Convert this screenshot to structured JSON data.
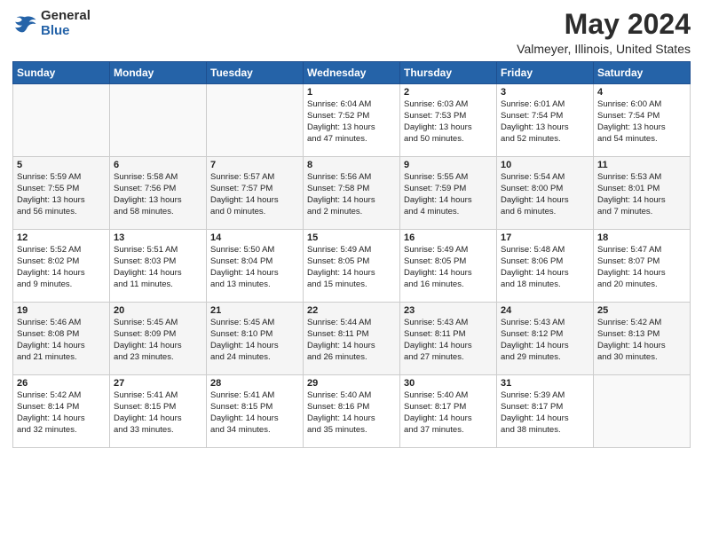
{
  "header": {
    "logo_general": "General",
    "logo_blue": "Blue",
    "month_title": "May 2024",
    "location": "Valmeyer, Illinois, United States"
  },
  "weekdays": [
    "Sunday",
    "Monday",
    "Tuesday",
    "Wednesday",
    "Thursday",
    "Friday",
    "Saturday"
  ],
  "weeks": [
    [
      {
        "day": "",
        "info": ""
      },
      {
        "day": "",
        "info": ""
      },
      {
        "day": "",
        "info": ""
      },
      {
        "day": "1",
        "info": "Sunrise: 6:04 AM\nSunset: 7:52 PM\nDaylight: 13 hours\nand 47 minutes."
      },
      {
        "day": "2",
        "info": "Sunrise: 6:03 AM\nSunset: 7:53 PM\nDaylight: 13 hours\nand 50 minutes."
      },
      {
        "day": "3",
        "info": "Sunrise: 6:01 AM\nSunset: 7:54 PM\nDaylight: 13 hours\nand 52 minutes."
      },
      {
        "day": "4",
        "info": "Sunrise: 6:00 AM\nSunset: 7:54 PM\nDaylight: 13 hours\nand 54 minutes."
      }
    ],
    [
      {
        "day": "5",
        "info": "Sunrise: 5:59 AM\nSunset: 7:55 PM\nDaylight: 13 hours\nand 56 minutes."
      },
      {
        "day": "6",
        "info": "Sunrise: 5:58 AM\nSunset: 7:56 PM\nDaylight: 13 hours\nand 58 minutes."
      },
      {
        "day": "7",
        "info": "Sunrise: 5:57 AM\nSunset: 7:57 PM\nDaylight: 14 hours\nand 0 minutes."
      },
      {
        "day": "8",
        "info": "Sunrise: 5:56 AM\nSunset: 7:58 PM\nDaylight: 14 hours\nand 2 minutes."
      },
      {
        "day": "9",
        "info": "Sunrise: 5:55 AM\nSunset: 7:59 PM\nDaylight: 14 hours\nand 4 minutes."
      },
      {
        "day": "10",
        "info": "Sunrise: 5:54 AM\nSunset: 8:00 PM\nDaylight: 14 hours\nand 6 minutes."
      },
      {
        "day": "11",
        "info": "Sunrise: 5:53 AM\nSunset: 8:01 PM\nDaylight: 14 hours\nand 7 minutes."
      }
    ],
    [
      {
        "day": "12",
        "info": "Sunrise: 5:52 AM\nSunset: 8:02 PM\nDaylight: 14 hours\nand 9 minutes."
      },
      {
        "day": "13",
        "info": "Sunrise: 5:51 AM\nSunset: 8:03 PM\nDaylight: 14 hours\nand 11 minutes."
      },
      {
        "day": "14",
        "info": "Sunrise: 5:50 AM\nSunset: 8:04 PM\nDaylight: 14 hours\nand 13 minutes."
      },
      {
        "day": "15",
        "info": "Sunrise: 5:49 AM\nSunset: 8:05 PM\nDaylight: 14 hours\nand 15 minutes."
      },
      {
        "day": "16",
        "info": "Sunrise: 5:49 AM\nSunset: 8:05 PM\nDaylight: 14 hours\nand 16 minutes."
      },
      {
        "day": "17",
        "info": "Sunrise: 5:48 AM\nSunset: 8:06 PM\nDaylight: 14 hours\nand 18 minutes."
      },
      {
        "day": "18",
        "info": "Sunrise: 5:47 AM\nSunset: 8:07 PM\nDaylight: 14 hours\nand 20 minutes."
      }
    ],
    [
      {
        "day": "19",
        "info": "Sunrise: 5:46 AM\nSunset: 8:08 PM\nDaylight: 14 hours\nand 21 minutes."
      },
      {
        "day": "20",
        "info": "Sunrise: 5:45 AM\nSunset: 8:09 PM\nDaylight: 14 hours\nand 23 minutes."
      },
      {
        "day": "21",
        "info": "Sunrise: 5:45 AM\nSunset: 8:10 PM\nDaylight: 14 hours\nand 24 minutes."
      },
      {
        "day": "22",
        "info": "Sunrise: 5:44 AM\nSunset: 8:11 PM\nDaylight: 14 hours\nand 26 minutes."
      },
      {
        "day": "23",
        "info": "Sunrise: 5:43 AM\nSunset: 8:11 PM\nDaylight: 14 hours\nand 27 minutes."
      },
      {
        "day": "24",
        "info": "Sunrise: 5:43 AM\nSunset: 8:12 PM\nDaylight: 14 hours\nand 29 minutes."
      },
      {
        "day": "25",
        "info": "Sunrise: 5:42 AM\nSunset: 8:13 PM\nDaylight: 14 hours\nand 30 minutes."
      }
    ],
    [
      {
        "day": "26",
        "info": "Sunrise: 5:42 AM\nSunset: 8:14 PM\nDaylight: 14 hours\nand 32 minutes."
      },
      {
        "day": "27",
        "info": "Sunrise: 5:41 AM\nSunset: 8:15 PM\nDaylight: 14 hours\nand 33 minutes."
      },
      {
        "day": "28",
        "info": "Sunrise: 5:41 AM\nSunset: 8:15 PM\nDaylight: 14 hours\nand 34 minutes."
      },
      {
        "day": "29",
        "info": "Sunrise: 5:40 AM\nSunset: 8:16 PM\nDaylight: 14 hours\nand 35 minutes."
      },
      {
        "day": "30",
        "info": "Sunrise: 5:40 AM\nSunset: 8:17 PM\nDaylight: 14 hours\nand 37 minutes."
      },
      {
        "day": "31",
        "info": "Sunrise: 5:39 AM\nSunset: 8:17 PM\nDaylight: 14 hours\nand 38 minutes."
      },
      {
        "day": "",
        "info": ""
      }
    ]
  ]
}
